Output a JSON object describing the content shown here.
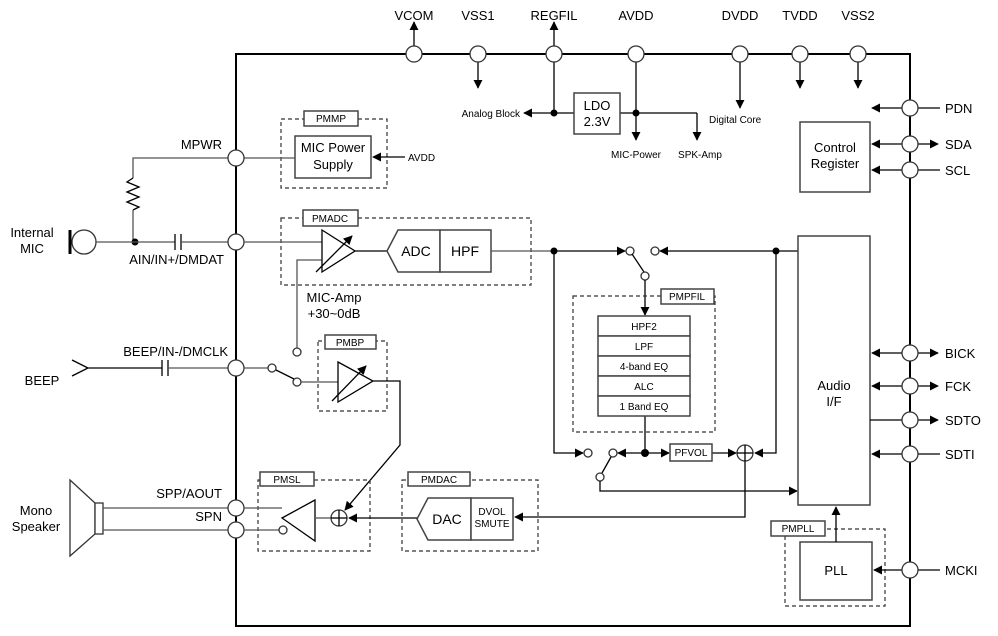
{
  "top_pins": [
    "VCOM",
    "VSS1",
    "REGFIL",
    "AVDD",
    "DVDD",
    "TVDD",
    "VSS2"
  ],
  "right_pins": [
    "PDN",
    "SDA",
    "SCL",
    "BICK",
    "FCK",
    "SDTO",
    "SDTI",
    "MCKI"
  ],
  "left_pins": [
    "MPWR",
    "AIN/IN+/DMDAT",
    "BEEP/IN-/DMCLK",
    "SPP/AOUT",
    "SPN"
  ],
  "external": {
    "mic": [
      "Internal",
      "MIC"
    ],
    "beep": "BEEP",
    "speaker": [
      "Mono",
      "Speaker"
    ]
  },
  "power": {
    "ldo": [
      "LDO",
      "2.3V"
    ],
    "analog_block": "Analog Block",
    "digital_core": "Digital Core",
    "mic_power": "MIC-Power",
    "spk_amp": "SPK-Amp",
    "avdd_in": "AVDD"
  },
  "blocks": {
    "pmmp": "PMMP",
    "mic_power_supply": [
      "MIC Power",
      "Supply"
    ],
    "pmadc": "PMADC",
    "adc": "ADC",
    "hpf": "HPF",
    "mic_amp": [
      "MIC-Amp",
      "+30~0dB"
    ],
    "pmbp": "PMBP",
    "pmsl": "PMSL",
    "pmdac": "PMDAC",
    "dac": "DAC",
    "dvol": [
      "DVOL",
      "SMUTE"
    ],
    "pmpfil": "PMPFIL",
    "filters": [
      "HPF2",
      "LPF",
      "4-band EQ",
      "ALC",
      "1 Band EQ"
    ],
    "pfvol": "PFVOL",
    "control_register": [
      "Control",
      "Register"
    ],
    "audio_if": [
      "Audio",
      "I/F"
    ],
    "pmpll": "PMPLL",
    "pll": "PLL"
  }
}
